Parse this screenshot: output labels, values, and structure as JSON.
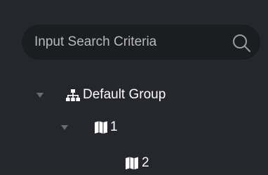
{
  "search": {
    "placeholder": "Input Search Criteria",
    "icon": "search-icon"
  },
  "tree": {
    "nodes": [
      {
        "label": "Default Group",
        "icon": "org-chart-icon",
        "expanded": true,
        "level": 0
      },
      {
        "label": "1",
        "icon": "map-icon",
        "expanded": true,
        "level": 1
      },
      {
        "label": "2",
        "icon": "map-icon",
        "expanded": false,
        "level": 2
      }
    ]
  },
  "colors": {
    "background": "#26272c",
    "search_box": "#1c1d21",
    "text": "#ffffff",
    "placeholder": "#b8b9be",
    "expander": "#6b6c71"
  }
}
